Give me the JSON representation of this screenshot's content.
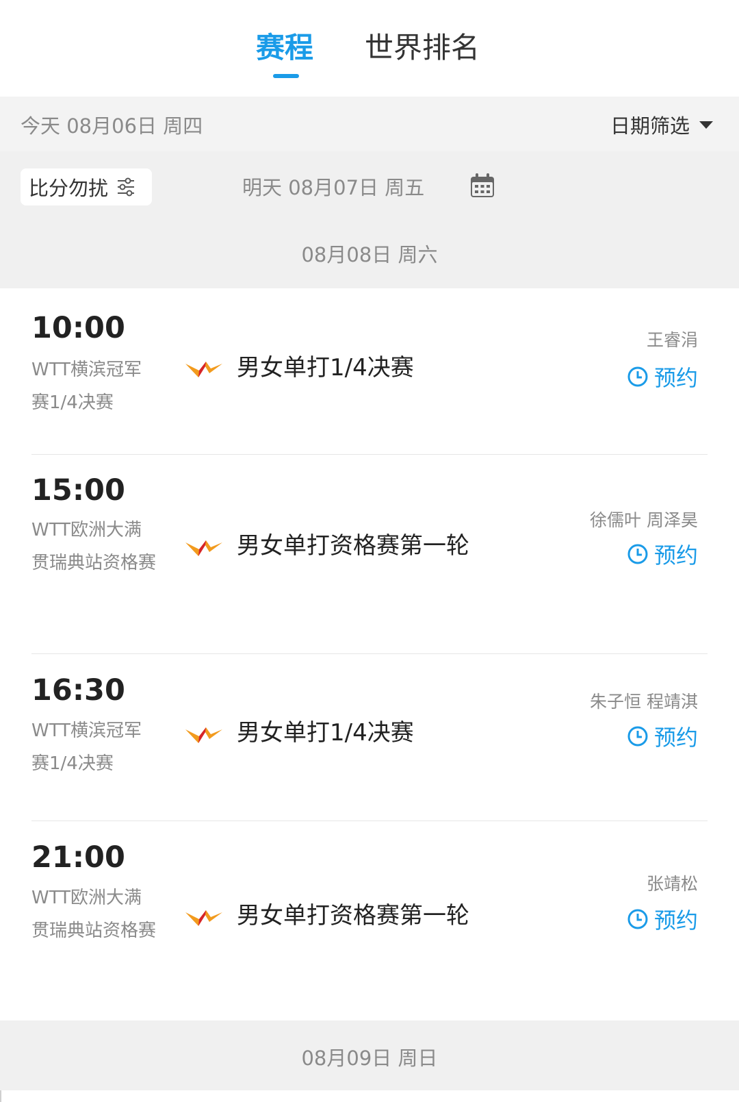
{
  "tabs": [
    {
      "label": "赛程",
      "active": true
    },
    {
      "label": "世界排名",
      "active": false
    }
  ],
  "date_header": {
    "today": "今天 08月06日 周四",
    "filter_label": "日期筛选"
  },
  "controls": {
    "no_disturb_label": "比分勿扰",
    "tomorrow": "明天  08月07日  周五",
    "saturday": "08月08日  周六"
  },
  "matches": [
    {
      "time": "10:00",
      "event": "WTT横滨冠军赛1/4决赛",
      "title": "男女单打1/4决赛",
      "players": "王睿涓",
      "action": "预约"
    },
    {
      "time": "15:00",
      "event": "WTT欧洲大满贯瑞典站资格赛",
      "title": "男女单打资格赛第一轮",
      "players": "徐儒叶 周泽昊",
      "action": "预约"
    },
    {
      "time": "16:30",
      "event": "WTT横滨冠军赛1/4决赛",
      "title": "男女单打1/4决赛",
      "players": "朱子恒 程靖淇",
      "action": "预约"
    },
    {
      "time": "21:00",
      "event": "WTT欧洲大满贯瑞典站资格赛",
      "title": "男女单打资格赛第一轮",
      "players": "张靖松",
      "action": "预约"
    }
  ],
  "bottom_date": "08月09日  周日",
  "colors": {
    "accent": "#1a9be8",
    "band_bg": "#f0f0f0",
    "muted_text": "#8a8a8a"
  },
  "icons": {
    "filter": "caret-down-icon",
    "no_disturb": "sliders-icon",
    "calendar": "calendar-icon",
    "reserve": "clock-icon",
    "tournament": "wtt-logo"
  }
}
